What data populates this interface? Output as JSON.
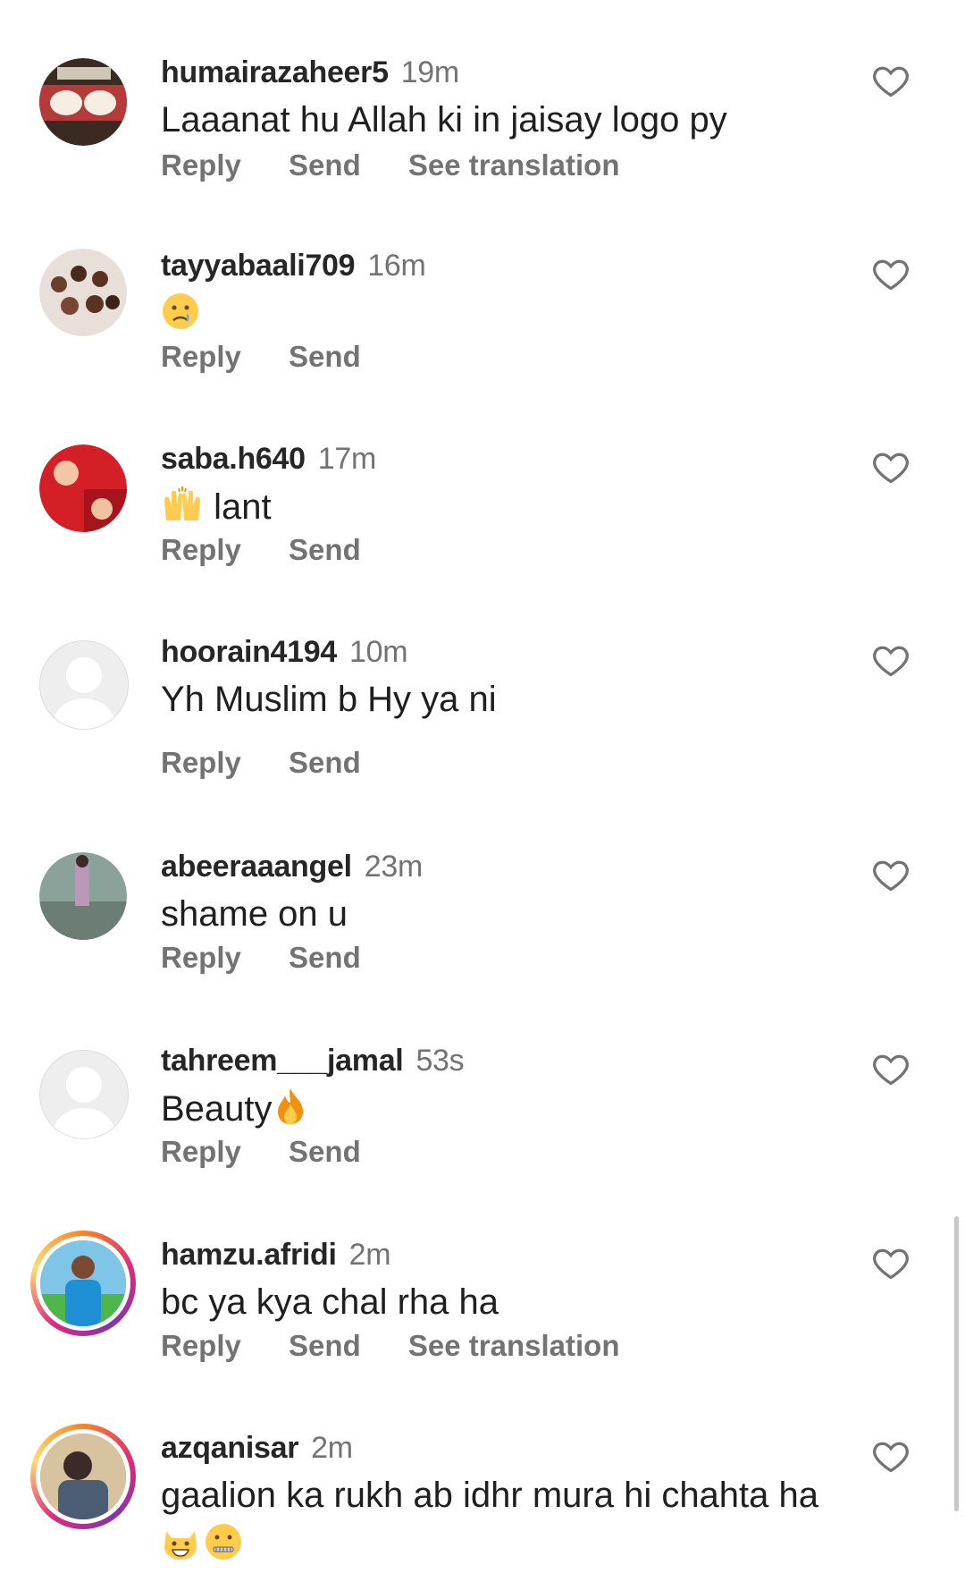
{
  "actions": {
    "reply": "Reply",
    "send": "Send",
    "translate": "See translation"
  },
  "comments": [
    {
      "username": "humairazaheer5",
      "time": "19m",
      "text": "Laaanat hu Allah ki  in jaisay logo py",
      "has_translate": true
    },
    {
      "username": "tayyabaali709",
      "time": "16m",
      "text": "",
      "emoji": "crying-face"
    },
    {
      "username": "saba.h640",
      "time": "17m",
      "text": "lant",
      "emoji": "raising-hands"
    },
    {
      "username": "hoorain4194",
      "time": "10m",
      "text": "Yh Muslim b Hy ya ni"
    },
    {
      "username": "abeeraaangel",
      "time": "23m",
      "text": "shame on u"
    },
    {
      "username": "tahreem___jamal",
      "time": "53s",
      "text": "Beauty",
      "emoji": "fire"
    },
    {
      "username": "hamzu.afridi",
      "time": "2m",
      "text": "bc ya kya chal rha ha",
      "has_translate": true
    },
    {
      "username": "azqanisar",
      "time": "2m",
      "text": "gaalion ka rukh ab idhr mura hi chahta ha",
      "emoji": "grinning-cat-and-zipper-mouth"
    }
  ],
  "colors": {
    "secondary_text": "#737373",
    "story_ring": "#dd2a7b"
  }
}
